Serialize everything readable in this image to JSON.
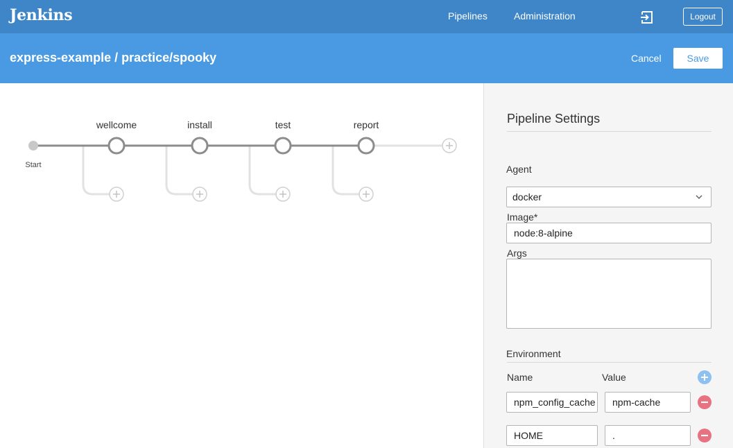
{
  "header": {
    "logo": "Jenkins",
    "nav": {
      "pipelines": "Pipelines",
      "administration": "Administration"
    },
    "logout": "Logout",
    "icons": {
      "exit": "exit-icon"
    }
  },
  "subheader": {
    "title": "express-example / practice/spooky",
    "cancel": "Cancel",
    "save": "Save"
  },
  "pipeline": {
    "start_label": "Start",
    "stages": [
      {
        "name": "wellcome"
      },
      {
        "name": "install"
      },
      {
        "name": "test"
      },
      {
        "name": "report"
      }
    ]
  },
  "settings": {
    "title": "Pipeline Settings",
    "agent_label": "Agent",
    "agent_value": "docker",
    "image_label": "Image*",
    "image_value": "node:8-alpine",
    "args_label": "Args",
    "args_value": "",
    "environment": {
      "label": "Environment",
      "name_header": "Name",
      "value_header": "Value",
      "rows": [
        {
          "name": "npm_config_cache",
          "value": "npm-cache"
        },
        {
          "name": "HOME",
          "value": "."
        }
      ]
    }
  },
  "colors": {
    "topbar": "#3e86c8",
    "subbar": "#4a9ae3",
    "add": "#8ec0f0",
    "remove": "#e8727f",
    "stage_node": "#8c8c8c"
  }
}
